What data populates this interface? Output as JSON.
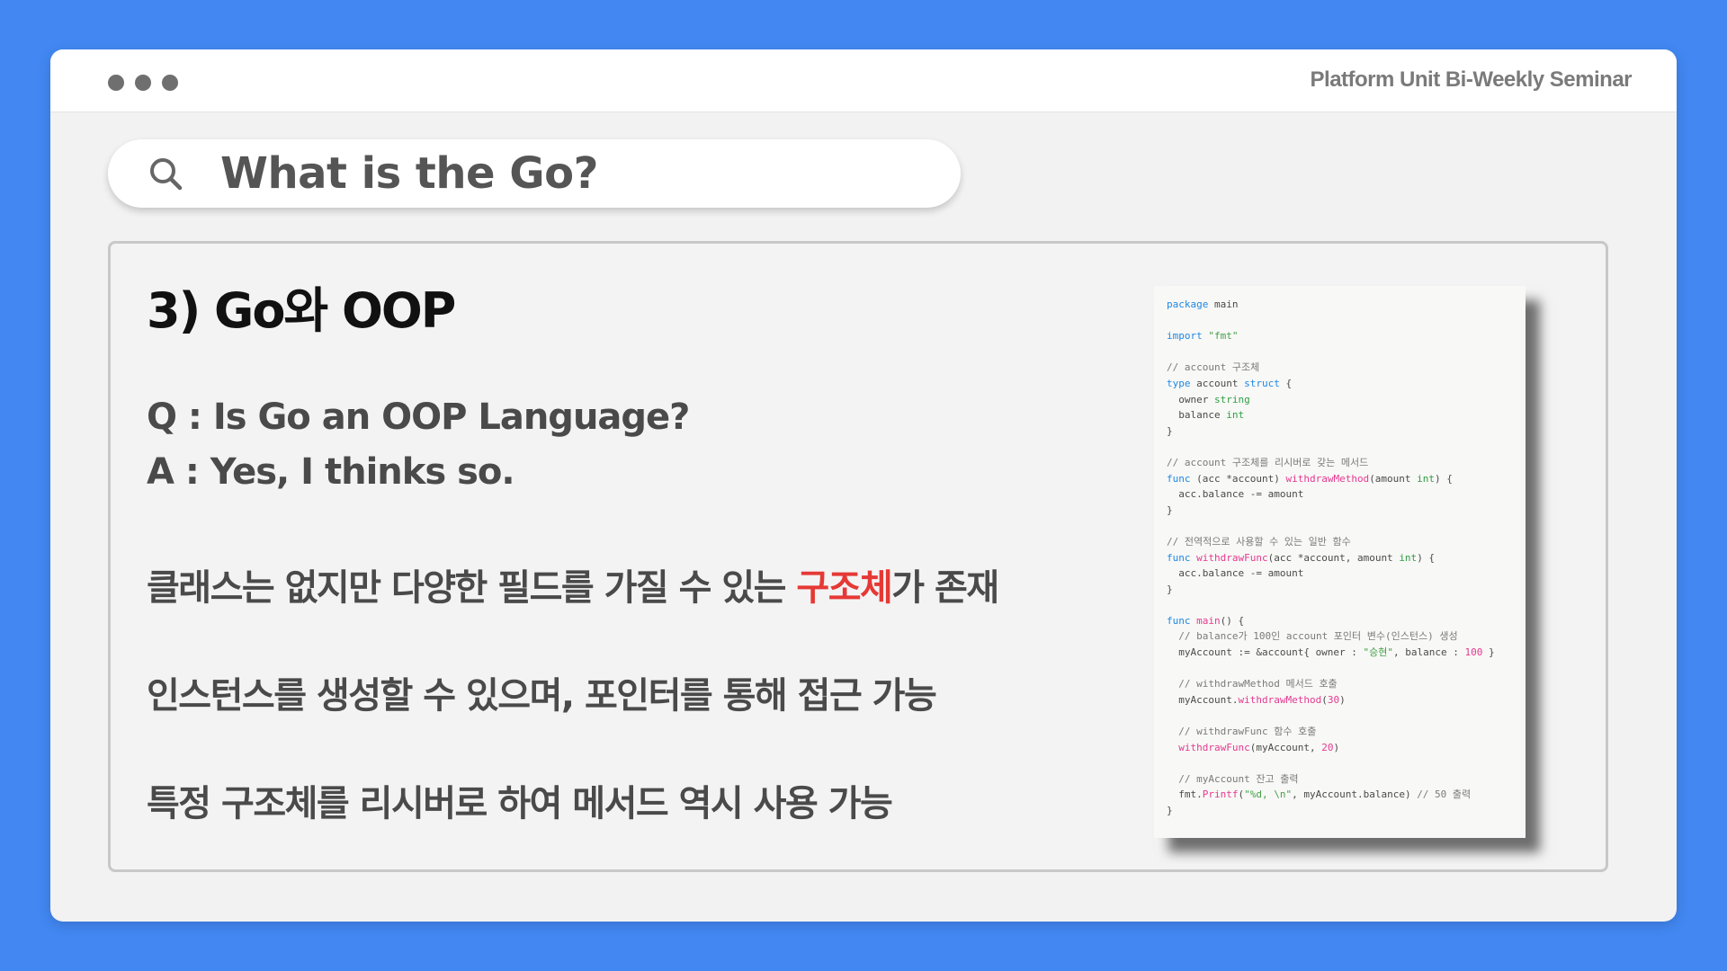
{
  "window": {
    "header_title": "Platform Unit Bi-Weekly Seminar"
  },
  "search": {
    "query": "What is the Go?"
  },
  "slide": {
    "section_title": "3) Go와 OOP",
    "question": "Q : Is Go an OOP Language?",
    "answer": "A : Yes, I thinks so.",
    "para1_before": "클래스는 없지만 다양한 필드를 가질 수 있는 ",
    "para1_highlight": "구조체",
    "para1_after": "가 존재",
    "para2": "인스턴스를 생성할 수 있으며, 포인터를 통해 접근 가능",
    "para3": "특정 구조체를 리시버로 하여 메서드 역시 사용 가능"
  },
  "code": {
    "lines": [
      "package main",
      "",
      "import \"fmt\"",
      "",
      "// account 구조체",
      "type account struct {",
      "  owner string",
      "  balance int",
      "}",
      "",
      "// account 구조체를 리시버로 갖는 메서드",
      "func (acc *account) withdrawMethod(amount int) {",
      "  acc.balance -= amount",
      "}",
      "",
      "// 전역적으로 사용할 수 있는 일반 함수",
      "func withdrawFunc(acc *account, amount int) {",
      "  acc.balance -= amount",
      "}",
      "",
      "func main() {",
      "  // balance가 100인 account 포인터 변수(인스턴스) 생성",
      "  myAccount := &account{ owner : \"승현\", balance : 100 }",
      "",
      "  // withdrawMethod 메서드 호출",
      "  myAccount.withdrawMethod(30)",
      "",
      "  // withdrawFunc 함수 호출",
      "  withdrawFunc(myAccount, 20)",
      "",
      "  // myAccount 잔고 출력",
      "  fmt.Printf(\"%d, \\n\", myAccount.balance) // 50 출력",
      "}"
    ]
  },
  "colors": {
    "background": "#4287f2",
    "highlight": "#e53935",
    "text": "#4a4a4a"
  }
}
